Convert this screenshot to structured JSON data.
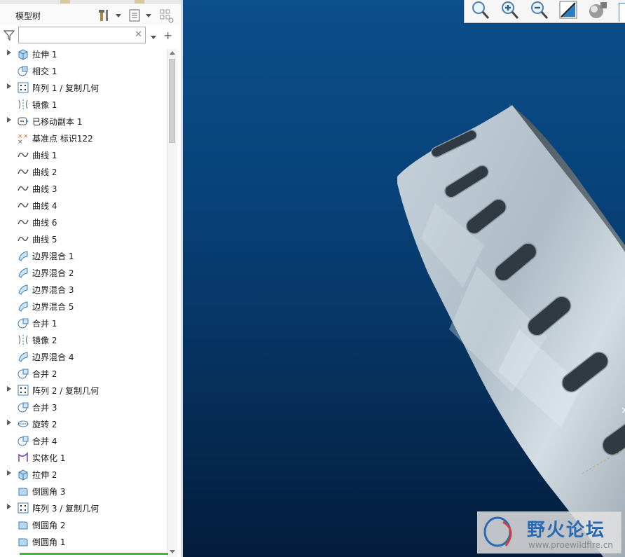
{
  "model_tree": {
    "title": "模型树",
    "search": {
      "value": "",
      "placeholder": ""
    },
    "items": [
      {
        "label": "拉伸 1",
        "icon": "extrude-icon",
        "expandable": true
      },
      {
        "label": "相交 1",
        "icon": "intersect-icon",
        "expandable": false
      },
      {
        "label": "阵列 1 / 复制几何",
        "icon": "pattern-icon",
        "expandable": true
      },
      {
        "label": "镜像 1",
        "icon": "mirror-icon",
        "expandable": false
      },
      {
        "label": "已移动副本 1",
        "icon": "moved-copy-icon",
        "expandable": true
      },
      {
        "label": "基准点 标识122",
        "icon": "datum-point-icon",
        "expandable": false
      },
      {
        "label": "曲线 1",
        "icon": "curve-icon",
        "expandable": false
      },
      {
        "label": "曲线 2",
        "icon": "curve-icon",
        "expandable": false
      },
      {
        "label": "曲线 3",
        "icon": "curve-icon",
        "expandable": false
      },
      {
        "label": "曲线 4",
        "icon": "curve-icon",
        "expandable": false
      },
      {
        "label": "曲线 6",
        "icon": "curve-icon",
        "expandable": false
      },
      {
        "label": "曲线 5",
        "icon": "curve-icon",
        "expandable": false
      },
      {
        "label": "边界混合 1",
        "icon": "boundary-blend-icon",
        "expandable": false
      },
      {
        "label": "边界混合 2",
        "icon": "boundary-blend-icon",
        "expandable": false
      },
      {
        "label": "边界混合 3",
        "icon": "boundary-blend-icon",
        "expandable": false
      },
      {
        "label": "边界混合 5",
        "icon": "boundary-blend-icon",
        "expandable": false
      },
      {
        "label": "合并 1",
        "icon": "merge-icon",
        "expandable": false
      },
      {
        "label": "镜像 2",
        "icon": "mirror-icon",
        "expandable": false
      },
      {
        "label": "边界混合 4",
        "icon": "boundary-blend-icon",
        "expandable": false
      },
      {
        "label": "合并 2",
        "icon": "merge-icon",
        "expandable": false
      },
      {
        "label": "阵列 2 / 复制几何",
        "icon": "pattern-icon",
        "expandable": true
      },
      {
        "label": "合并 3",
        "icon": "merge-icon",
        "expandable": false
      },
      {
        "label": "旋转 2",
        "icon": "revolve-icon",
        "expandable": true
      },
      {
        "label": "合并 4",
        "icon": "merge-icon",
        "expandable": false
      },
      {
        "label": "实体化 1",
        "icon": "solidify-icon",
        "expandable": false
      },
      {
        "label": "拉伸 2",
        "icon": "extrude-icon",
        "expandable": true
      },
      {
        "label": "倒圆角 3",
        "icon": "round-icon",
        "expandable": false
      },
      {
        "label": "阵列 3 / 复制几何",
        "icon": "pattern-icon",
        "expandable": true
      },
      {
        "label": "倒圆角 2",
        "icon": "round-icon",
        "expandable": false
      },
      {
        "label": "倒圆角 1",
        "icon": "round-icon",
        "expandable": false
      }
    ]
  },
  "view_toolbar": [
    "refit-icon",
    "zoom-in-icon",
    "zoom-out-icon",
    "repaint-icon",
    "display-style-icon"
  ],
  "watermark": {
    "title": "野火论坛",
    "url": "www.proewildfire.cn"
  },
  "colors": {
    "viewport_top": "#0b4f8c",
    "viewport_bottom": "#041c3c",
    "part": "#b4c3cd"
  }
}
